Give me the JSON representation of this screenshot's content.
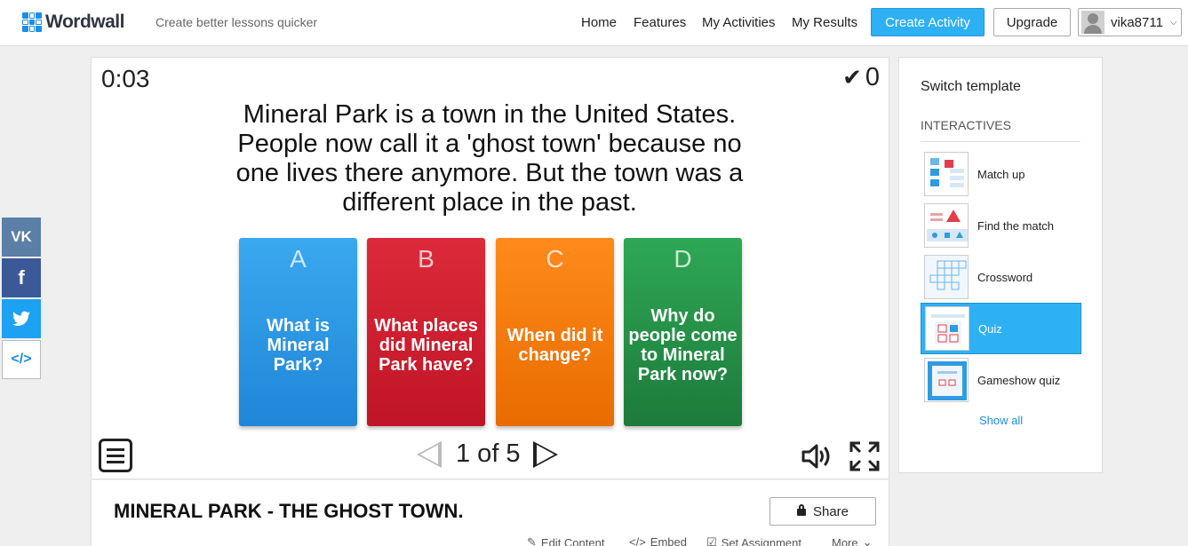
{
  "header": {
    "logo_text": "Wordwall",
    "tagline": "Create better lessons quicker",
    "nav": [
      "Home",
      "Features",
      "My Activities",
      "My Results"
    ],
    "create_label": "Create Activity",
    "upgrade_label": "Upgrade",
    "username": "vika8711"
  },
  "social": {
    "vk": "VK",
    "facebook": "f",
    "twitter": "twitter-bird-icon",
    "embed": "</>"
  },
  "game": {
    "timer": "0:03",
    "score": "0",
    "question": "Mineral Park is a town in the United States. People now call it a 'ghost town' because no one lives there anymore. But the town was a different place in the past.",
    "answers": [
      {
        "letter": "A",
        "text": "What is Mineral Park?",
        "color": "#2a98e6"
      },
      {
        "letter": "B",
        "text": "What places did Mineral Park have?",
        "color": "#d21f30"
      },
      {
        "letter": "C",
        "text": "When did it change?",
        "color": "#f57a0e"
      },
      {
        "letter": "D",
        "text": "Why do people come to Mineral Park now?",
        "color": "#26904a"
      }
    ],
    "page": "1 of 5"
  },
  "activity": {
    "title": "MINERAL PARK - THE GHOST TOWN.",
    "share_label": "Share",
    "actions": [
      "Edit Content",
      "Embed",
      "Set Assignment",
      "More"
    ]
  },
  "sidebar": {
    "title": "Switch template",
    "subtitle": "INTERACTIVES",
    "templates": [
      {
        "label": "Match up",
        "icon": "match-up-icon"
      },
      {
        "label": "Find the match",
        "icon": "find-the-match-icon"
      },
      {
        "label": "Crossword",
        "icon": "crossword-icon"
      },
      {
        "label": "Quiz",
        "icon": "quiz-icon"
      },
      {
        "label": "Gameshow quiz",
        "icon": "gameshow-quiz-icon"
      }
    ],
    "show_all": "Show all"
  },
  "colors": {
    "accent": "#2eb0f5",
    "brand": "#1a8fe3"
  }
}
